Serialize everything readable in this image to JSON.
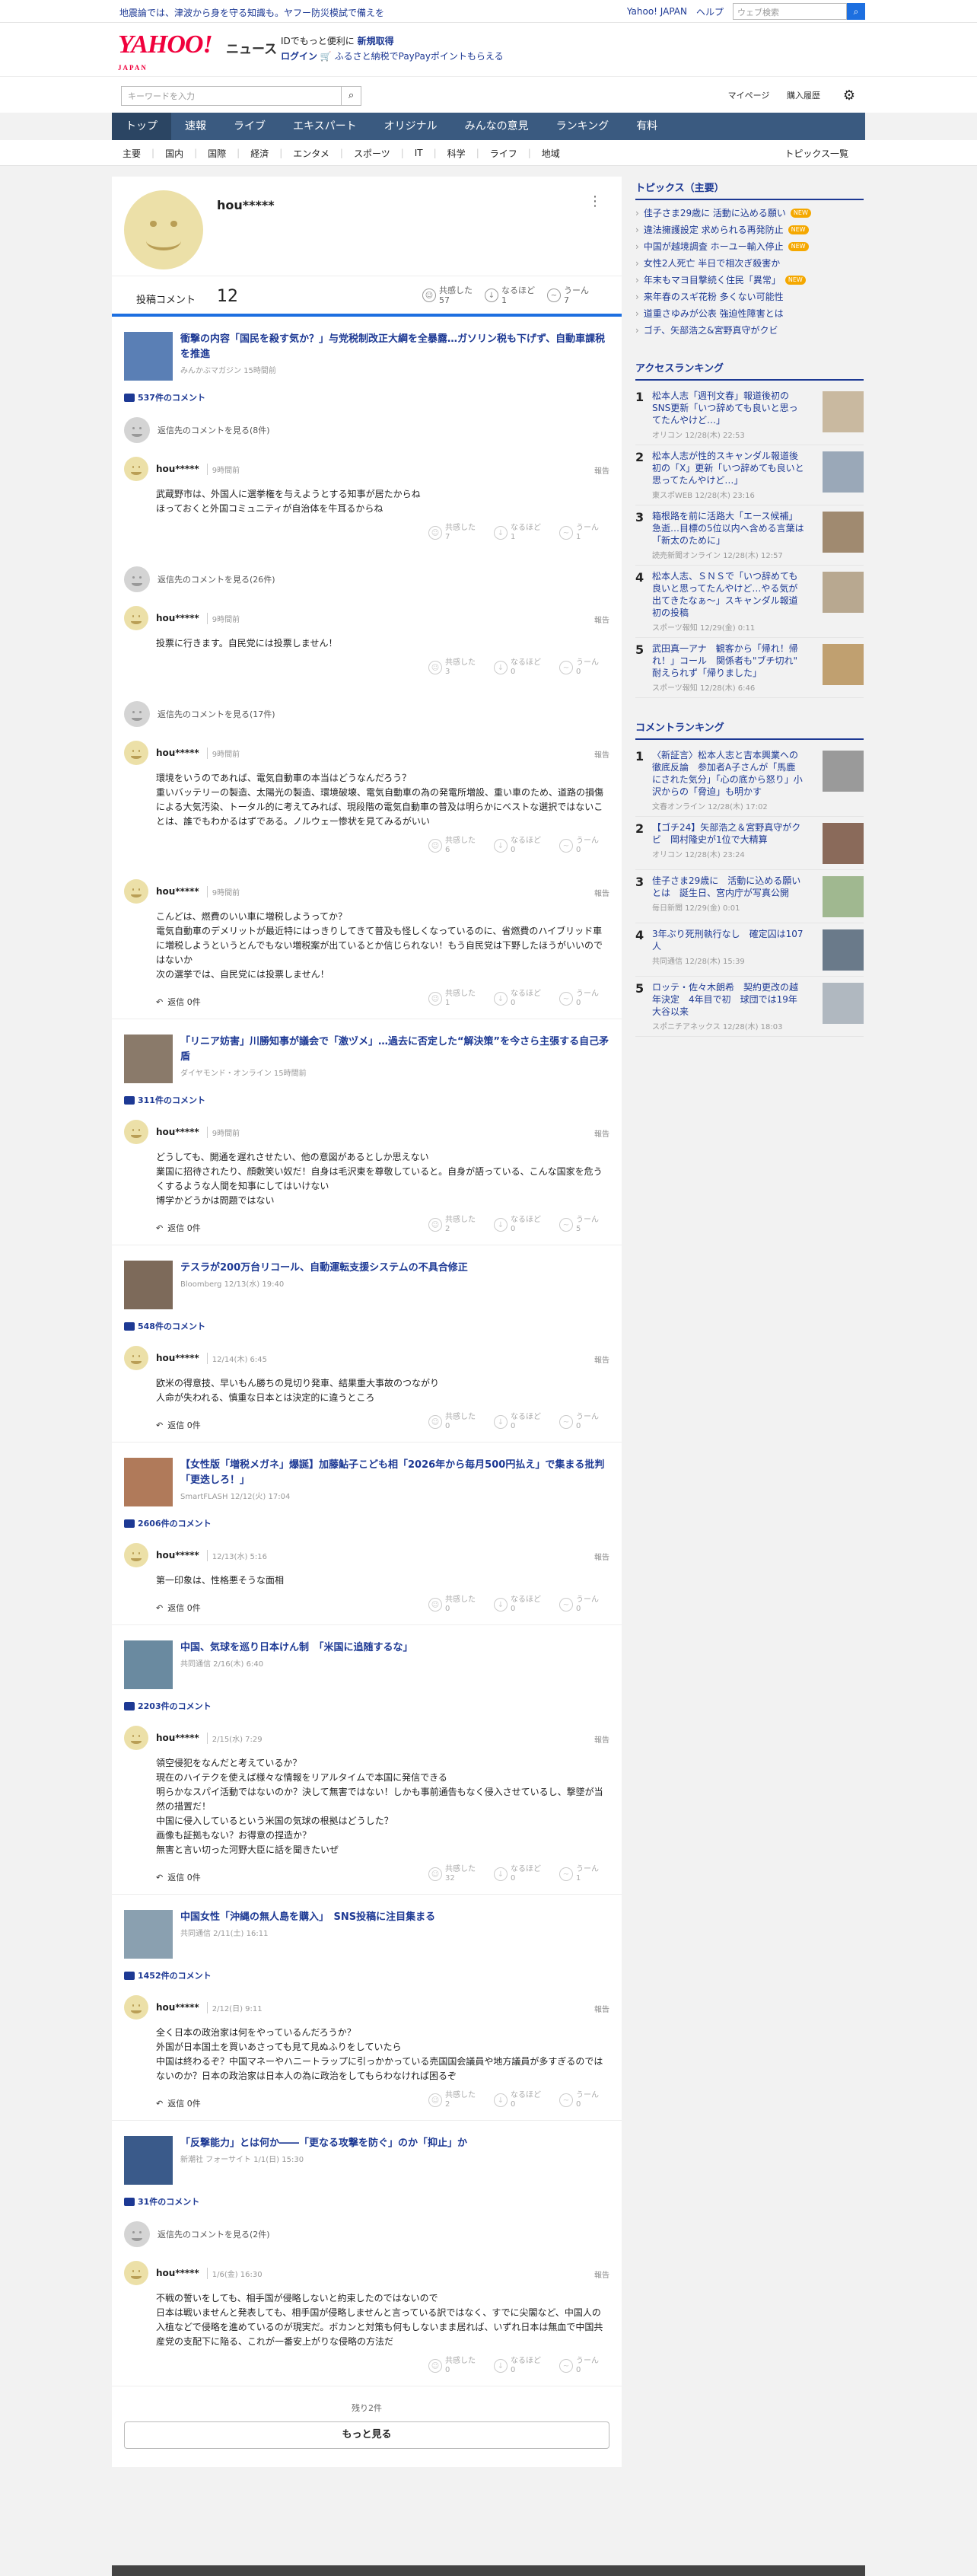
{
  "topbar": {
    "alert": "地震論では、津波から身を守る知識も。ヤフー防災模試で備えを",
    "links": [
      "Yahoo! JAPAN",
      "ヘルプ"
    ],
    "search_placeholder": "ウェブ検索"
  },
  "header": {
    "logo": "YAHOO!",
    "logo_sub": "JAPAN",
    "service": "ニュース",
    "promo1a": "IDでもっと便利に",
    "promo1b": "新規取得",
    "login": "ログイン",
    "promo2": "ふるさと納税でPayPayポイントもらえる"
  },
  "searchbar": {
    "placeholder": "キーワードを入力",
    "mypage": "マイページ",
    "history": "購入履歴"
  },
  "gnav": [
    "トップ",
    "速報",
    "ライブ",
    "エキスパート",
    "オリジナル",
    "みんなの意見",
    "ランキング",
    "有料"
  ],
  "cnav": {
    "items": [
      "主要",
      "国内",
      "国際",
      "経済",
      "エンタメ",
      "スポーツ",
      "IT",
      "科学",
      "ライフ",
      "地域"
    ],
    "topics_list": "トピックス一覧"
  },
  "profile": {
    "name": "hou*****",
    "menu": "⋮",
    "comments_label": "投稿コメント",
    "comments_count": "12",
    "reactions": [
      {
        "label": "共感した",
        "count": "57"
      },
      {
        "label": "なるほど",
        "count": "1"
      },
      {
        "label": "うーん",
        "count": "7"
      }
    ]
  },
  "reaction_labels": [
    "共感した",
    "なるほど",
    "うーん"
  ],
  "reply_label": "返信 0件",
  "report_label": "報告",
  "articles": [
    {
      "title": "衝撃の内容「国民を殺す気か？」与党税制改正大綱を全暴露…ガソリン税も下げず、自動車課税を推進",
      "source": "みんかぶマガジン 15時間前",
      "count": "537件のコメント",
      "comments": [
        {
          "reply_view": "返信先のコメントを見る(8件)",
          "name": "hou*****",
          "time": "9時間前",
          "text": [
            "武蔵野市は、外国人に選挙権を与えようとする知事が居たからね",
            "ほっておくと外国コミュニティが自治体を牛耳るからね"
          ],
          "r": [
            "7",
            "1",
            "1"
          ],
          "show_reply": false
        },
        {
          "reply_view": "返信先のコメントを見る(26件)",
          "name": "hou*****",
          "time": "9時間前",
          "text": [
            "投票に行きます。自民党には投票しません！"
          ],
          "r": [
            "3",
            "0",
            "0"
          ],
          "show_reply": false
        },
        {
          "reply_view": "返信先のコメントを見る(17件)",
          "name": "hou*****",
          "time": "9時間前",
          "text": [
            "環境をいうのであれば、電気自動車の本当はどうなんだろう？",
            "重いバッテリーの製造、太陽光の製造、環境破壊、電気自動車の為の発電所増設、重い車のため、道路の損傷による大気汚染、トータル的に考えてみれば、現段階の電気自動車の普及は明らかにベストな選択ではないことは、誰でもわかるはずである。ノルウェー惨状を見てみるがいい"
          ],
          "r": [
            "6",
            "0",
            "0"
          ],
          "show_reply": false
        },
        {
          "reply_view": "",
          "name": "hou*****",
          "time": "9時間前",
          "text": [
            "こんどは、燃費のいい車に増税しようってか？",
            "電気自動車のデメリットが最近特にはっきりしてきて普及も怪しくなっているのに、省燃費のハイブリッド車に増税しようというとんでもない増税案が出ているとか信じられない！もう自民党は下野したほうがいいのではないか",
            "次の選挙では、自民党には投票しません！"
          ],
          "r": [
            "1",
            "0",
            "0"
          ],
          "show_reply": true
        }
      ]
    },
    {
      "title": "「リニア妨害」川勝知事が議会で「激ヅメ」…過去に否定した“解決策”を今さら主張する自己矛盾",
      "source": "ダイヤモンド・オンライン 15時間前",
      "count": "311件のコメント",
      "comments": [
        {
          "reply_view": "",
          "name": "hou*****",
          "time": "9時間前",
          "text": [
            "どうしても、開通を遅れさせたい、他の意図があるとしか思えない",
            "業国に招待されたり、顔敷笑い奴だ！自身は毛沢東を尊敬していると。自身が語っている、こんな国家を危うくするような人間を知事にしてはいけない",
            "博学かどうかは問題ではない"
          ],
          "r": [
            "2",
            "0",
            "5"
          ],
          "show_reply": true
        }
      ]
    },
    {
      "title": "テスラが200万台リコール、自動運転支援システムの不具合修正",
      "source": "Bloomberg 12/13(水) 19:40",
      "count": "548件のコメント",
      "comments": [
        {
          "reply_view": "",
          "name": "hou*****",
          "time": "12/14(木) 6:45",
          "text": [
            "欧米の得意技、早いもん勝ちの見切り発車、結果重大事故のつながり",
            "人命が失われる、慎重な日本とは決定的に違うところ"
          ],
          "r": [
            "0",
            "0",
            "0"
          ],
          "show_reply": true
        }
      ]
    },
    {
      "title": "【女性版「増税メガネ」爆誕】加藤鮎子こども相「2026年から毎月500円払え」で集まる批判「更迭しろ！」",
      "source": "SmartFLASH 12/12(火) 17:04",
      "count": "2606件のコメント",
      "comments": [
        {
          "reply_view": "",
          "name": "hou*****",
          "time": "12/13(水) 5:16",
          "text": [
            "第一印象は、性格悪そうな面相"
          ],
          "r": [
            "0",
            "0",
            "0"
          ],
          "show_reply": true
        }
      ]
    },
    {
      "title": "中国、気球を巡り日本けん制　「米国に追随するな」",
      "source": "共同通信 2/16(木) 6:40",
      "count": "2203件のコメント",
      "comments": [
        {
          "reply_view": "",
          "name": "hou*****",
          "time": "2/15(水) 7:29",
          "text": [
            "領空侵犯をなんだと考えているか？",
            "現在のハイテクを使えば様々な情報をリアルタイムで本国に発信できる",
            "明らかなスパイ活動ではないのか？決して無害ではない！しかも事前通告もなく侵入させているし、撃墜が当然の措置だ！",
            "中国に侵入しているという米国の気球の根拠はどうした？",
            "画像も証拠もない？お得意の捏造か？",
            "無害と言い切った河野大臣に話を聞きたいぜ"
          ],
          "r": [
            "32",
            "0",
            "1"
          ],
          "show_reply": true
        }
      ]
    },
    {
      "title": "中国女性「沖縄の無人島を購入」　SNS投稿に注目集まる",
      "source": "共同通信 2/11(土) 16:11",
      "count": "1452件のコメント",
      "comments": [
        {
          "reply_view": "",
          "name": "hou*****",
          "time": "2/12(日) 9:11",
          "text": [
            "全く日本の政治家は何をやっているんだろうか？",
            "外国が日本国土を買いあさっても見て見ぬふりをしていたら",
            "中国は終わるぞ？中国マネーやハニートラップに引っかかっている売国国会議員や地方議員が多すぎるのではないのか？日本の政治家は日本人の為に政治をしてもらわなければ困るぞ"
          ],
          "r": [
            "2",
            "0",
            "0"
          ],
          "show_reply": true
        }
      ]
    },
    {
      "title": "「反撃能力」とは何か――「更なる攻撃を防ぐ」のか「抑止」か",
      "source": "新潮社 フォーサイト 1/1(日) 15:30",
      "count": "31件のコメント",
      "comments": [
        {
          "reply_view": "返信先のコメントを見る(2件)",
          "name": "hou*****",
          "time": "1/6(金) 16:30",
          "text": [
            "不戦の誓いをしても、相手国が侵略しないと約束したのではないので",
            "日本は戦いませんと発表しても、相手国が侵略しませんと言っている訳ではなく、すでに尖閣など、中国人の入植などで侵略を進めているのが現実だ。ボカンと対策も何もしないまま居れば、いずれ日本は無血で中国共産党の支配下に陥る、これが一番安上がりな侵略の方法だ"
          ],
          "r": [
            "0",
            "0",
            "0"
          ],
          "show_reply": false
        }
      ]
    }
  ],
  "more": {
    "remaining": "残り2件",
    "button": "もっと見る"
  },
  "sidebar": {
    "topics_title": "トピックス（主要）",
    "topics": [
      {
        "t": "佳子さま29歳に 活動に込める願い",
        "new": true
      },
      {
        "t": "違法擁護設定 求められる再発防止",
        "new": true
      },
      {
        "t": "中国が越境調査 ホーユー輸入停止",
        "new": true
      },
      {
        "t": "女性2人死亡 半日で相次ぎ殺害か",
        "new": false
      },
      {
        "t": "年末もマヨ目撃続く住民「異常」",
        "new": true
      },
      {
        "t": "来年春のスギ花粉 多くない可能性",
        "new": false
      },
      {
        "t": "道重さゆみが公表 強迫性障害とは",
        "new": false
      },
      {
        "t": "ゴチ、矢部浩之&宮野真守がクビ",
        "new": false
      }
    ],
    "new_label": "NEW",
    "access_title": "アクセスランキング",
    "access": [
      {
        "n": "1",
        "t": "松本人志「週刊文春」報道後初のSNS更新「いつ辞めても良いと思ってたんやけど…」",
        "s": "オリコン 12/28(木) 22:53"
      },
      {
        "n": "2",
        "t": "松本人志が性的スキャンダル報道後初の「X」更新「いつ辞めても良いと思ってたんやけど…」",
        "s": "東スポWEB 12/28(木) 23:16"
      },
      {
        "n": "3",
        "t": "箱根路を前に活路大「エース候補」急逝…目標の5位以内へ含める言葉は「新太のために」",
        "s": "読売新聞オンライン 12/28(木) 12:57"
      },
      {
        "n": "4",
        "t": "松本人志、ＳＮＳで「いつ辞めても良いと思ってたんやけど…やる気が出てきたなぁ～」スキャンダル報道初の投稿",
        "s": "スポーツ報知 12/29(金) 0:11"
      },
      {
        "n": "5",
        "t": "武田真一アナ　観客から「帰れ！帰れ！」コール　関係者も\"ブチ切れ\"　耐えられず「帰りました」",
        "s": "スポーツ報知 12/28(木) 6:46"
      }
    ],
    "comment_title": "コメントランキング",
    "comment_rank": [
      {
        "n": "1",
        "t": "〈新証言〉松本人志と吉本興業への徹底反論　参加者A子さんが「馬鹿にされた気分」「心の底から怒り」小沢からの「脅迫」も明かす",
        "s": "文春オンライン 12/28(木) 17:02"
      },
      {
        "n": "2",
        "t": "【ゴチ24】矢部浩之＆宮野真守がクビ　岡村隆史が1位で大精算",
        "s": "オリコン 12/28(木) 23:24"
      },
      {
        "n": "3",
        "t": "佳子さま29歳に　活動に込める願いとは　誕生日、宮内庁が写真公開",
        "s": "毎日新聞 12/29(金) 0:01"
      },
      {
        "n": "4",
        "t": "3年ぶり死刑執行なし　確定囚は107人",
        "s": "共同通信 12/28(木) 15:39"
      },
      {
        "n": "5",
        "t": "ロッテ・佐々木朗希　契約更改の越年決定　4年目で初　球団では19年大谷以来",
        "s": "スポニチアネックス 12/28(木) 18:03"
      }
    ]
  }
}
